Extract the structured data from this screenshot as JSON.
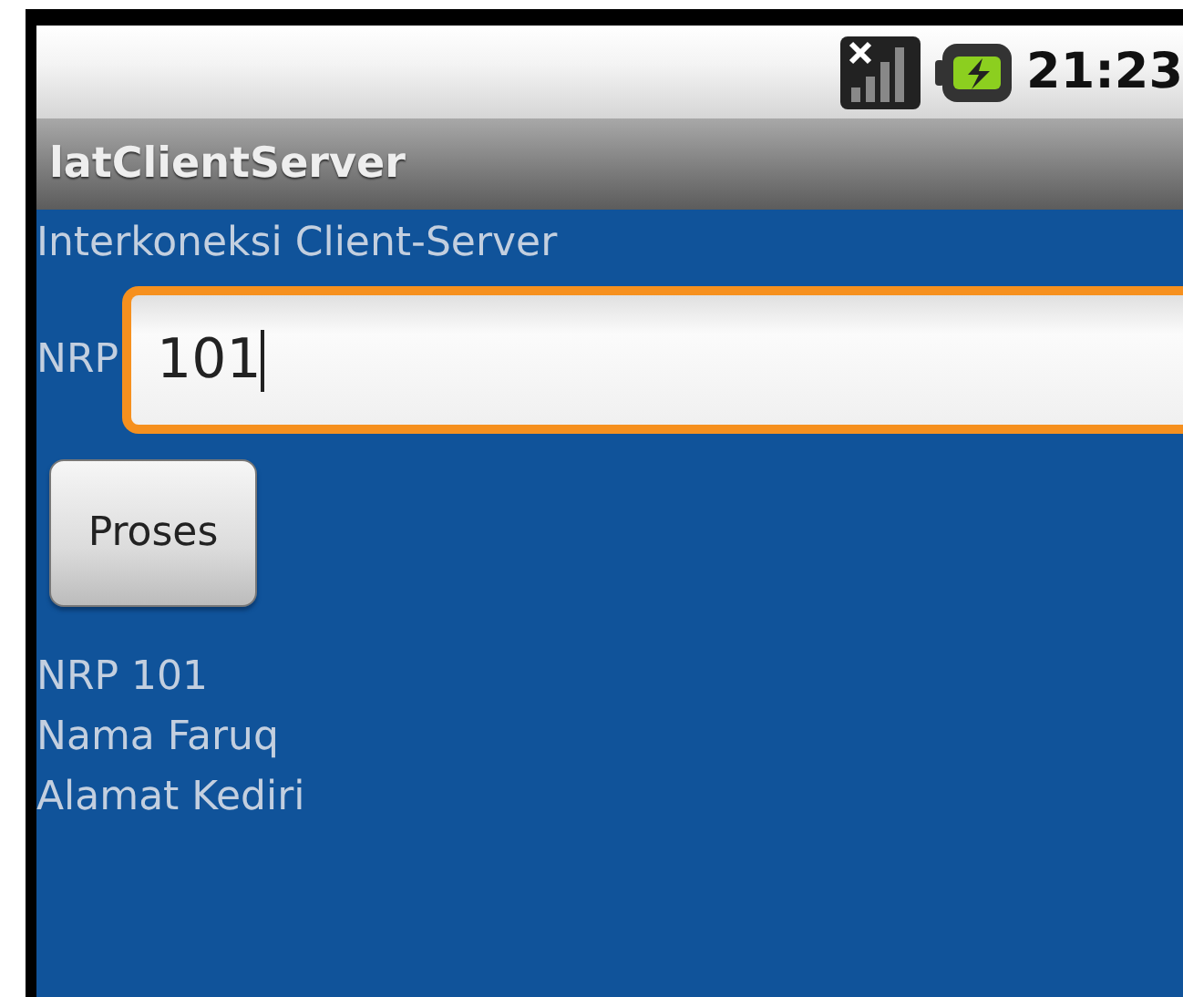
{
  "status_bar": {
    "time": "21:23"
  },
  "title_bar": {
    "title": "latClientServer"
  },
  "content": {
    "heading": "Interkoneksi Client-Server",
    "field": {
      "label": "NRP",
      "value": "101",
      "focused": true
    },
    "button": {
      "label": "Proses"
    },
    "results": [
      "NRP 101",
      "Nama Faruq",
      "Alamat Kediri"
    ]
  }
}
